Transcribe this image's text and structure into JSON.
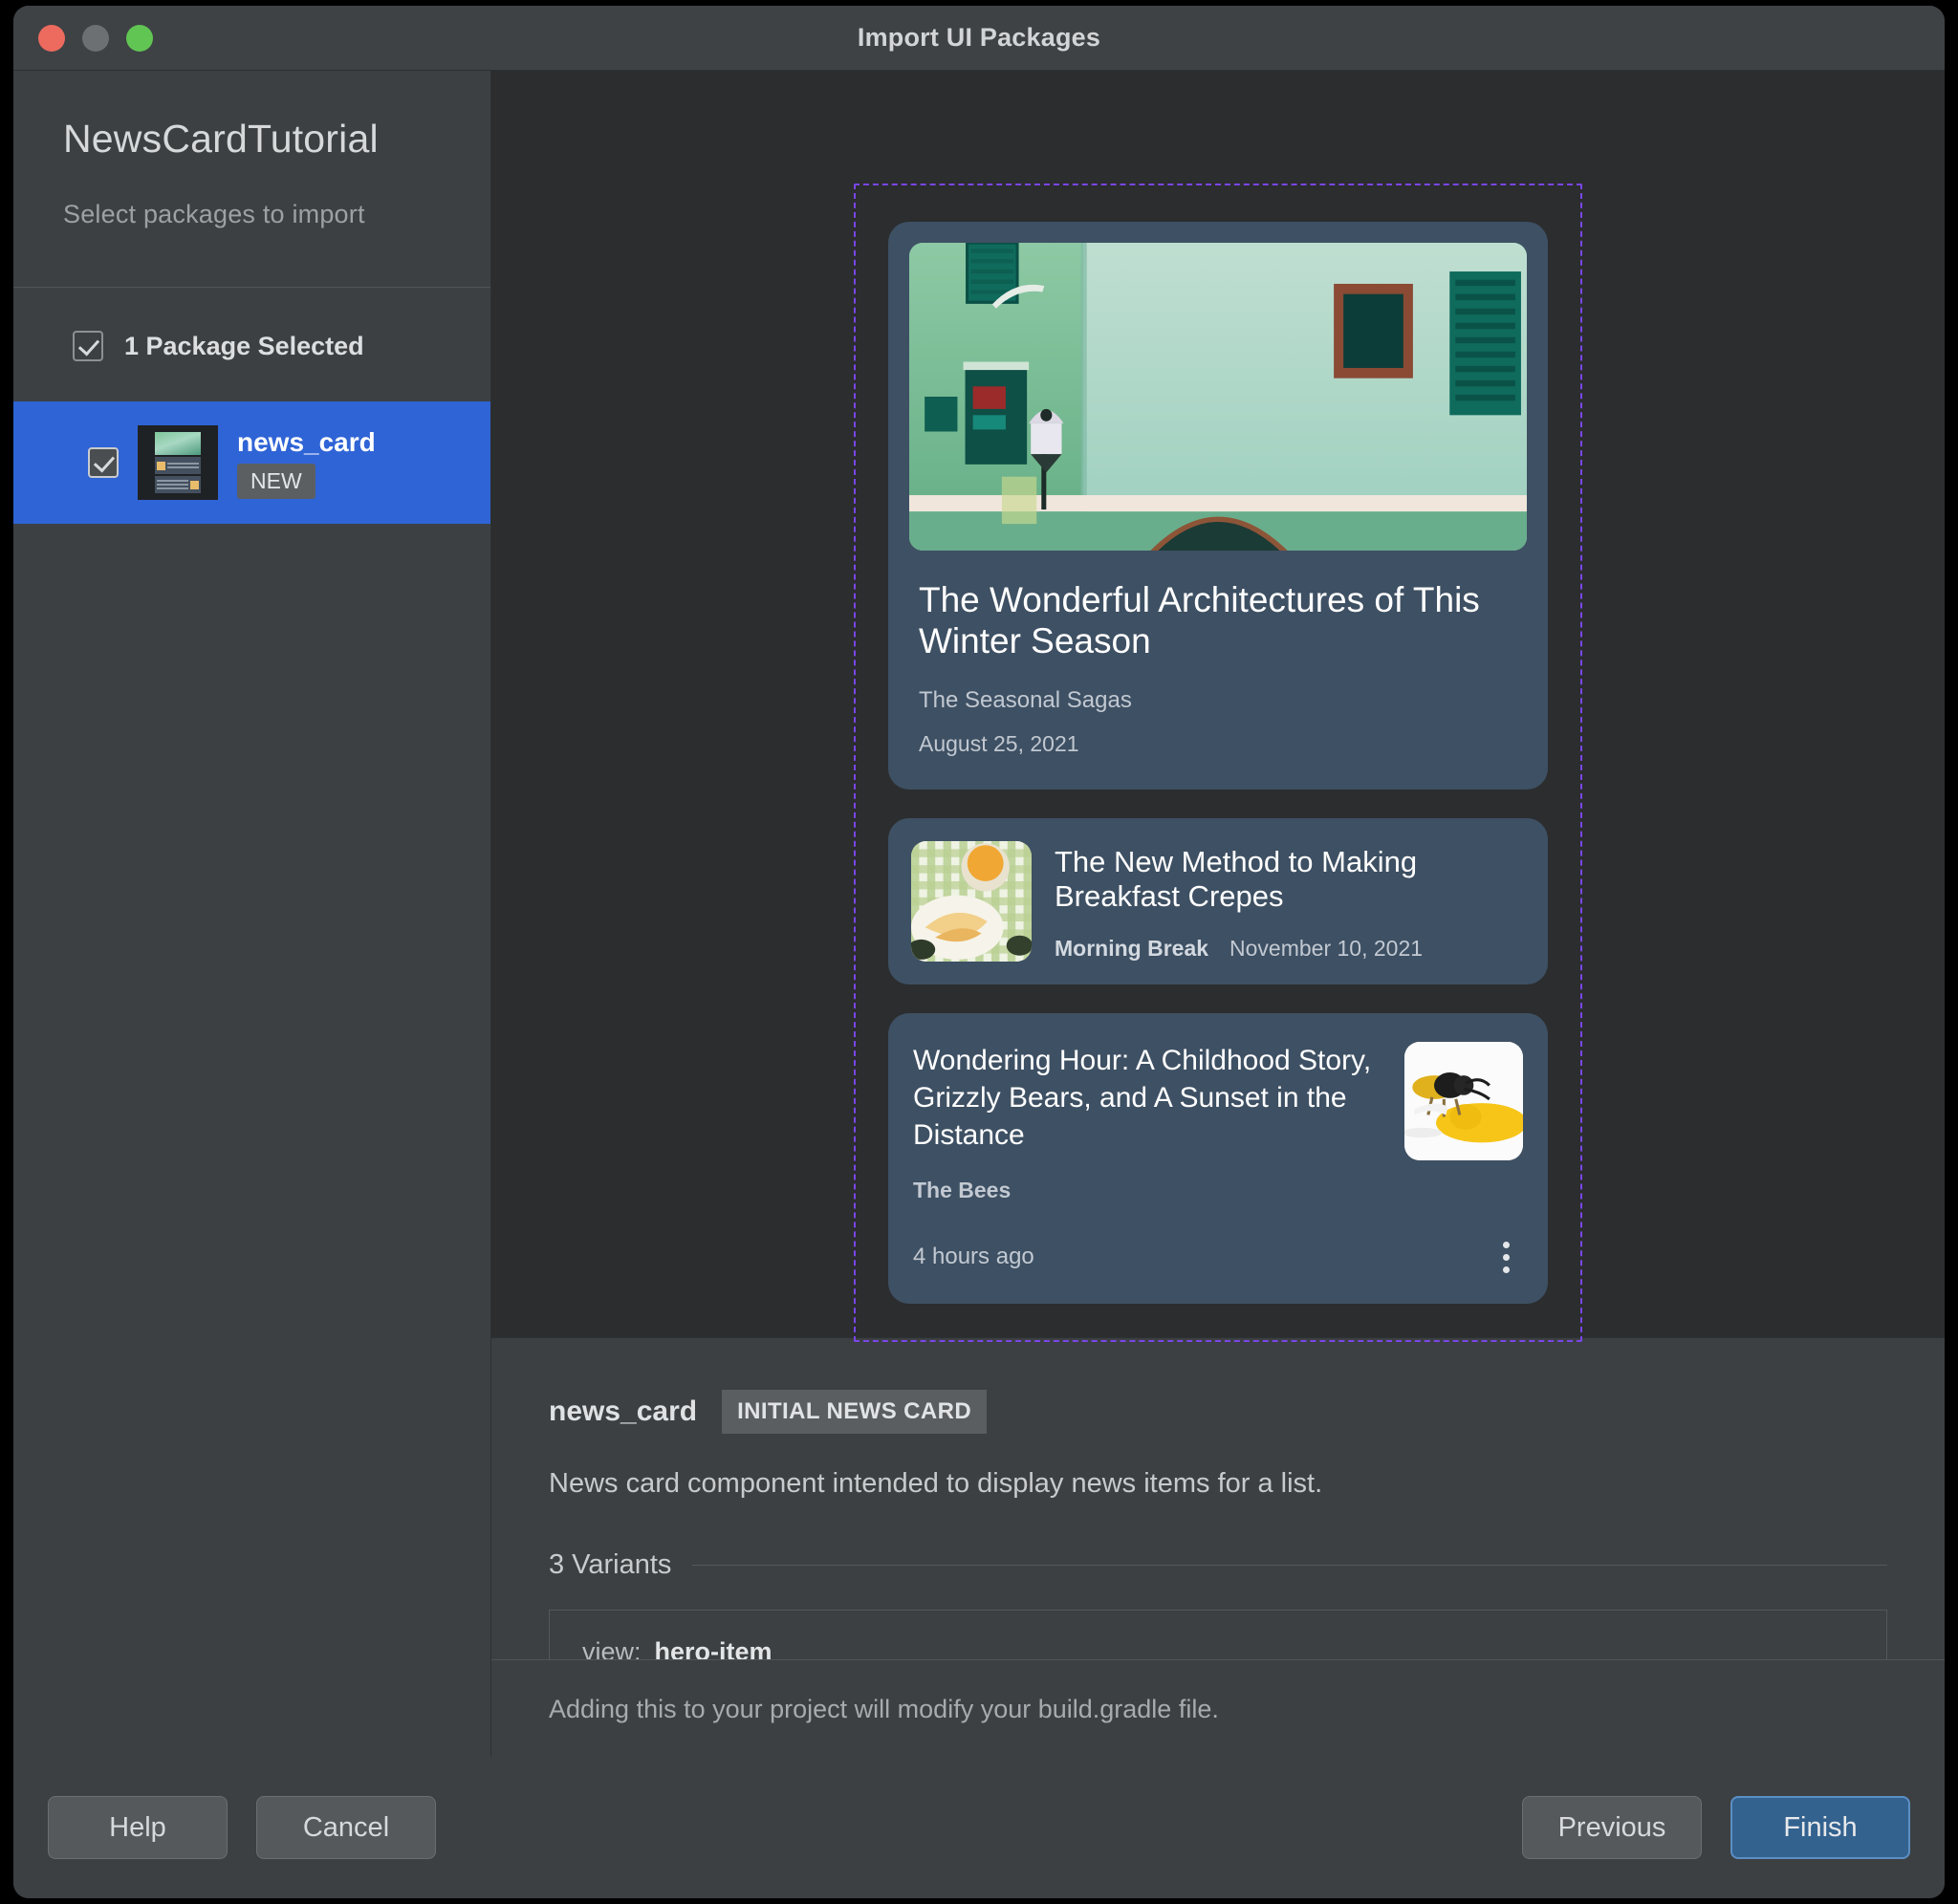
{
  "window": {
    "title": "Import UI Packages",
    "traffic_lights": [
      "close-button",
      "minimize-button",
      "zoom-button"
    ]
  },
  "sidebar": {
    "project_title": "NewsCardTutorial",
    "project_subtitle": "Select packages to import",
    "selection_summary": "1 Package Selected",
    "packages": [
      {
        "name": "news_card",
        "badge": "NEW",
        "checked": true,
        "selected": true
      }
    ]
  },
  "preview": {
    "cards": [
      {
        "variant": "hero-item",
        "title": "The Wonderful Architectures of This Winter Season",
        "source": "The Seasonal Sagas",
        "date": "August 25, 2021"
      },
      {
        "variant": "list-item",
        "title": "The New Method to Making Breakfast Crepes",
        "source": "Morning Break",
        "date": "November 10, 2021"
      },
      {
        "variant": "text-item",
        "title": "Wondering Hour: A Childhood Story, Grizzly Bears, and A Sunset in the Distance",
        "source": "The Bees",
        "date": "4 hours ago"
      }
    ],
    "selection_outline_color": "#7a46e8"
  },
  "details": {
    "name": "news_card",
    "tag": "INITIAL NEWS CARD",
    "description": "News card component intended to display news items for a list.",
    "variants_label": "3 Variants",
    "variants": [
      {
        "key": "view:",
        "value": "hero-item"
      }
    ]
  },
  "footer": {
    "note": "Adding this to your project will modify your build.gradle file."
  },
  "buttons": {
    "help": "Help",
    "cancel": "Cancel",
    "previous": "Previous",
    "finish": "Finish"
  },
  "colors": {
    "accent": "#2f64d6",
    "primary_button": "#33628f",
    "dashed_outline": "#7a46e8",
    "card_bg": "#3e5063",
    "window_bg": "#3c4042",
    "preview_bg": "#2b2d2f"
  }
}
